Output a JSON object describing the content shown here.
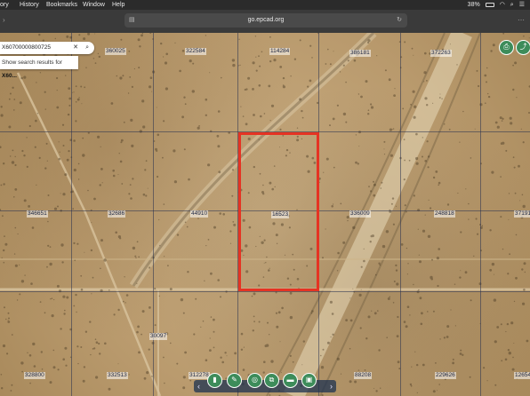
{
  "menubar": {
    "items": [
      "ory",
      "History",
      "Bookmarks",
      "Window",
      "Help"
    ],
    "battery": "38%",
    "wifi_icon": "wifi-icon",
    "control_icon": "control-center-icon"
  },
  "browser": {
    "url": "go.epcad.org"
  },
  "search": {
    "value": "X60700000800725",
    "suggestion_prefix": "Show search results for ",
    "suggestion_term": "X60..."
  },
  "parcels": [
    "360025",
    "322584",
    "114284",
    "386181",
    "372263",
    "346651",
    "32686",
    "44910",
    "16523",
    "336009",
    "248818",
    "37191",
    "30097",
    "328800",
    "332513",
    "312278",
    "88208",
    "229626",
    "12654"
  ],
  "colors": {
    "highlight": "#e53323",
    "button_green": "#3d8c5a"
  },
  "tools": [
    "bookmark-icon",
    "pencil-icon",
    "measure-icon",
    "layers-icon",
    "ruler-icon",
    "print-export-icon"
  ]
}
